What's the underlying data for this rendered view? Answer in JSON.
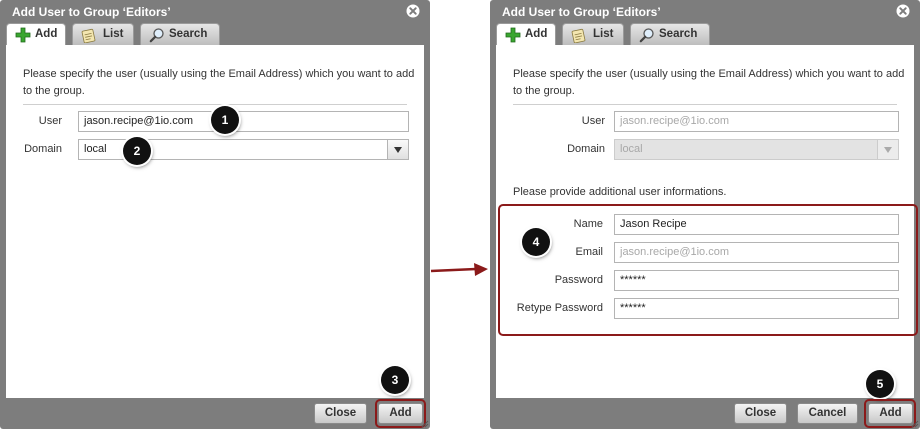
{
  "dialog_left": {
    "title": "Add User to Group ‘Editors’",
    "tabs": [
      {
        "label": "Add",
        "icon": "plus-icon",
        "active": true
      },
      {
        "label": "List",
        "icon": "notepad-icon",
        "active": false
      },
      {
        "label": "Search",
        "icon": "magnifier-icon",
        "active": false
      }
    ],
    "intro": "Please specify the user (usually using the Email Address) which you want to add to the group.",
    "user_label": "User",
    "user_value": "jason.recipe@1io.com",
    "domain_label": "Domain",
    "domain_value": "local",
    "close_button": "Close",
    "add_button": "Add",
    "badges": [
      "1",
      "2",
      "3"
    ]
  },
  "dialog_right": {
    "title": "Add User to Group ‘Editors’",
    "tabs": [
      {
        "label": "Add",
        "icon": "plus-icon",
        "active": true
      },
      {
        "label": "List",
        "icon": "notepad-icon",
        "active": false
      },
      {
        "label": "Search",
        "icon": "magnifier-icon",
        "active": false
      }
    ],
    "intro": "Please specify the user (usually using the Email Address) which you want to add to the group.",
    "user_label": "User",
    "user_value": "jason.recipe@1io.com",
    "domain_label": "Domain",
    "domain_value": "local",
    "additional_info": "Please provide additional user informations.",
    "name_label": "Name",
    "name_value": "Jason Recipe",
    "email_label": "Email",
    "email_value": "jason.recipe@1io.com",
    "password_label": "Password",
    "password_value": "******",
    "retype_label": "Retype Password",
    "retype_value": "******",
    "close_button": "Close",
    "cancel_button": "Cancel",
    "add_button": "Add",
    "badges": [
      "4",
      "5"
    ]
  },
  "colors": {
    "dialog_bg": "#7d7d7d",
    "highlight": "#8b1a1a",
    "badge": "#111111"
  }
}
